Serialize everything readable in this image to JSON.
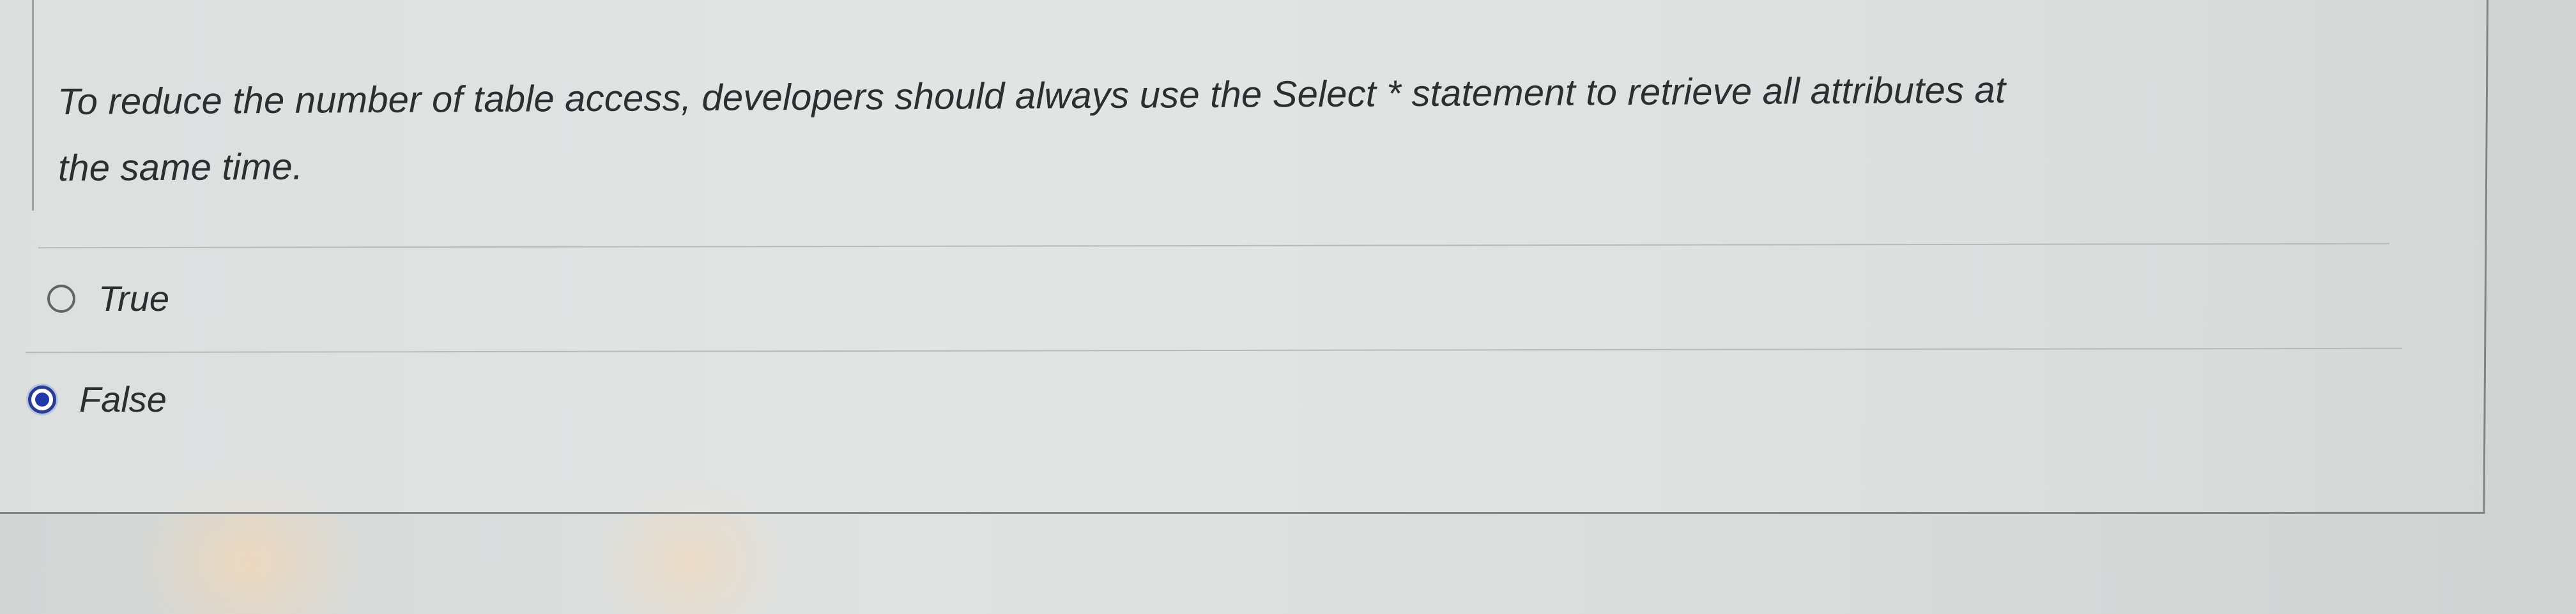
{
  "question": {
    "line1": "To reduce the number of table access, developers should always use the Select * statement to retrieve all attributes at",
    "line2": "the same time."
  },
  "options": [
    {
      "label": "True",
      "selected": false
    },
    {
      "label": "False",
      "selected": true
    }
  ],
  "colors": {
    "radio_selected": "#1f3aa6",
    "text": "#2c2f31",
    "border": "#7f8584"
  }
}
